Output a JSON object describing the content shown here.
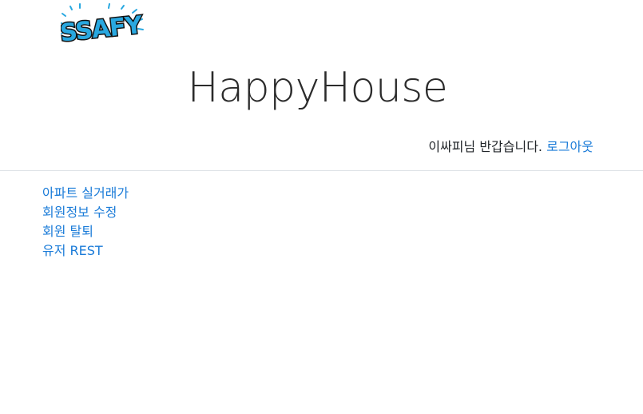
{
  "logo": {
    "text": "SSAFY",
    "fill_color": "#29a8e0",
    "outline_color": "#111111"
  },
  "header": {
    "title": "HappyHouse"
  },
  "user_bar": {
    "greeting": "이싸피님 반갑습니다.",
    "logout_label": "로그아웃"
  },
  "nav": {
    "items": [
      {
        "label": "아파트 실거래가"
      },
      {
        "label": "회원정보 수정"
      },
      {
        "label": "회원 탈퇴"
      },
      {
        "label": "유저 REST"
      }
    ]
  },
  "colors": {
    "link": "#1a7bd8",
    "text": "#212529",
    "divider": "#dee2e6"
  }
}
